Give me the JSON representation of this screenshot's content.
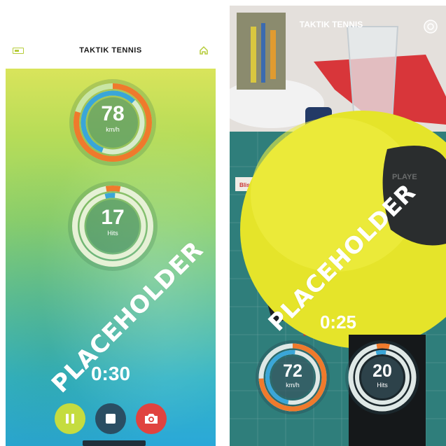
{
  "left_screen": {
    "title": "TAKTIK TENNIS",
    "speed": {
      "value": "78",
      "unit": "km/h"
    },
    "hits": {
      "value": "17",
      "unit": "Hits"
    },
    "timer": "0:30",
    "watermark": "PLACEHOLDER",
    "controls": {
      "pause": "pause-icon",
      "stop": "stop-icon",
      "camera": "camera-icon"
    }
  },
  "right_screen": {
    "title": "TAKTIK TENNIS",
    "timer": "0:25",
    "watermark": "PLACEHOLDER",
    "speed": {
      "value": "72",
      "unit": "km/h"
    },
    "hits": {
      "value": "20",
      "unit": "Hits"
    },
    "visible_labels": {
      "box_label": "Blistex",
      "ball_text": "PLAYE"
    }
  },
  "colors": {
    "ring_orange": "#ef7a2c",
    "ring_blue": "#3aa6d8",
    "ring_track": "#d9eccc",
    "camera_red": "#e0433f",
    "stop_dark": "#2a4e63",
    "pause_green": "#c5dc3f"
  }
}
